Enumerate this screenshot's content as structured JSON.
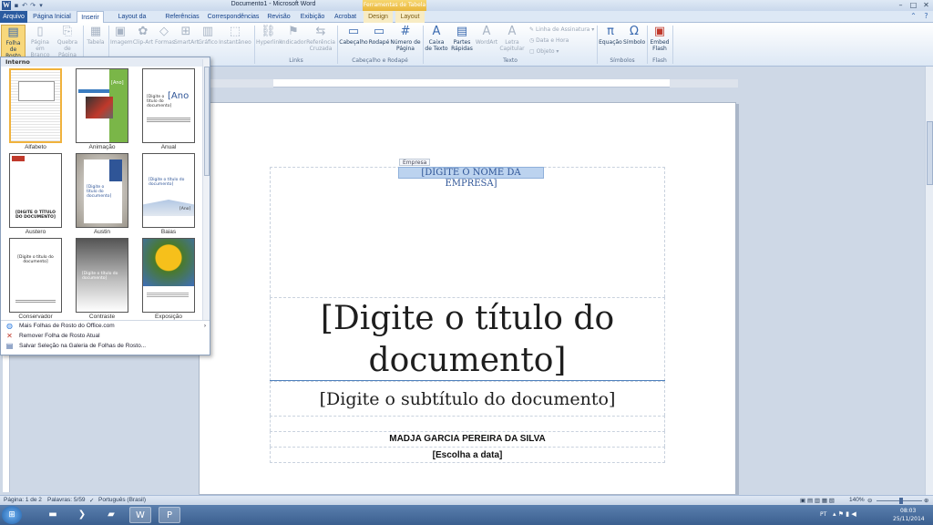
{
  "window": {
    "title": "Documento1 - Microsoft Word",
    "contextual_tab_title": "Ferramentas de Tabela",
    "minimize": "–",
    "maximize": "□",
    "close": "✕"
  },
  "tabs": [
    {
      "label": "Arquivo"
    },
    {
      "label": "Página Inicial"
    },
    {
      "label": "Inserir"
    },
    {
      "label": "Layout da Página"
    },
    {
      "label": "Referências"
    },
    {
      "label": "Correspondências"
    },
    {
      "label": "Revisão"
    },
    {
      "label": "Exibição"
    },
    {
      "label": "Acrobat"
    },
    {
      "label": "Design"
    },
    {
      "label": "Layout"
    }
  ],
  "ribbon": {
    "folha_de_rosto": "Folha de Rosto",
    "pagina_em_branco": "Página em Branco",
    "quebra_de_pagina": "Quebra de Página",
    "tabela": "Tabela",
    "imagem": "Imagem",
    "clip_art": "Clip-Art",
    "formas": "Formas",
    "smartart": "SmartArt",
    "grafico": "Gráfico",
    "instantaneo": "Instantâneo",
    "hyperlink": "Hyperlink",
    "indicador": "Indicador",
    "referencia_cruzada": "Referência Cruzada",
    "cabecalho": "Cabeçalho",
    "rodape": "Rodapé",
    "numero_de_pagina": "Número de Página",
    "caixa_de_texto": "Caixa de Texto",
    "partes_rapidas": "Partes Rápidas",
    "wordart": "WordArt",
    "letra_capitular": "Letra Capitular",
    "linha_de_assinatura": "Linha de Assinatura",
    "data_e_hora": "Data e Hora",
    "objeto": "Objeto",
    "equacao": "Equação",
    "simbolo": "Símbolo",
    "embed_flash": "Embed Flash",
    "groups": {
      "links": "Links",
      "cabecalho_rodape": "Cabeçalho e Rodapé",
      "texto": "Texto",
      "simbolos": "Símbolos",
      "flash": "Flash"
    }
  },
  "gallery": {
    "header": "Interno",
    "items": [
      {
        "label": "Alfabeto"
      },
      {
        "label": "Animação"
      },
      {
        "label": "Anual"
      },
      {
        "label": "Austero"
      },
      {
        "label": "Austin"
      },
      {
        "label": "Baias"
      },
      {
        "label": "Conservador"
      },
      {
        "label": "Contraste"
      },
      {
        "label": "Exposição"
      }
    ],
    "thumb_text": {
      "ano": "[Ano]",
      "ano_short": "[Ano",
      "anual_title": "[Digite o título do documento]",
      "austero_title": "[DIGITE O TÍTULO DO DOCUMENTO]",
      "austin_title": "[Digite o título do documento]",
      "conservador_title": "[Digite o título do documento]",
      "contraste_title": "[Digite o título do documento]"
    },
    "menu": [
      {
        "label": "Mais Folhas de Rosto do Office.com"
      },
      {
        "label": "Remover Folha de Rosto Atual"
      },
      {
        "label": "Salvar Seleção na Galeria de Folhas de Rosto..."
      }
    ]
  },
  "document": {
    "empresa_tag": "Empresa",
    "company_placeholder": "[DIGITE O NOME DA EMPRESA]",
    "title_placeholder": "[Digite o título do documento]",
    "subtitle_placeholder": "[Digite o subtítulo do documento]",
    "author": "MADJA GARCIA PEREIRA DA SILVA",
    "date_placeholder": "[Escolha a data]"
  },
  "status": {
    "page": "Página: 1 de 2",
    "words": "Palavras: 5/59",
    "language": "Português (Brasil)",
    "zoom": "140%"
  },
  "tray": {
    "lang": "PT",
    "time": "08:03",
    "date": "25/11/2014"
  },
  "colors": {
    "accent": "#2a5ba0",
    "contextual": "#e8b53a",
    "selection": "#bcd3ef"
  }
}
